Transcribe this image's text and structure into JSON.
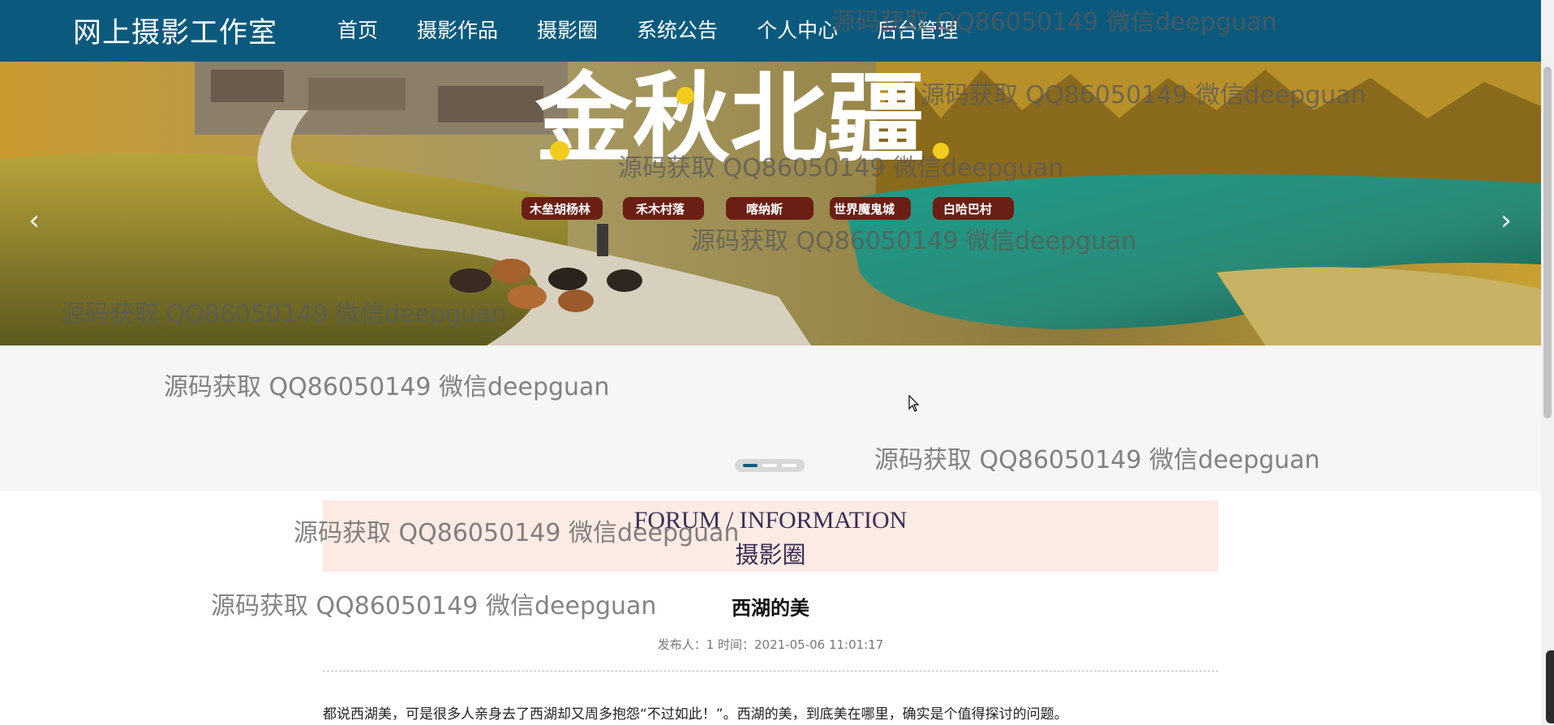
{
  "brand": "网上摄影工作室",
  "nav": [
    "首页",
    "摄影作品",
    "摄影圈",
    "系统公告",
    "个人中心",
    "后台管理"
  ],
  "banner": {
    "title": "金秋北疆",
    "tags": [
      "木垒胡杨林",
      "禾木村落",
      "喀纳斯",
      "世界魔鬼城",
      "白哈巴村"
    ],
    "prev_icon": "chevron-left-icon",
    "next_icon": "chevron-right-icon"
  },
  "carousel": {
    "slides": 3,
    "active": 1
  },
  "forum": {
    "title_en": "FORUM / INFORMATION",
    "title_cn": "摄影圈"
  },
  "post": {
    "title": "西湖的美",
    "meta": "发布人：1 时间：2021-05-06 11:01:17",
    "body": "都说西湖美，可是很多人亲身去了西湖却又周多抱怨“不过如此！”。西湖的美，到底美在哪里，确实是个值得探讨的问题。"
  },
  "watermark": "源码获取 QQ86050149 微信deepguan",
  "colors": {
    "nav_bg": "#0b5a7e",
    "forum_bg": "#fcebe4",
    "band_bg": "#f6f6f6"
  }
}
